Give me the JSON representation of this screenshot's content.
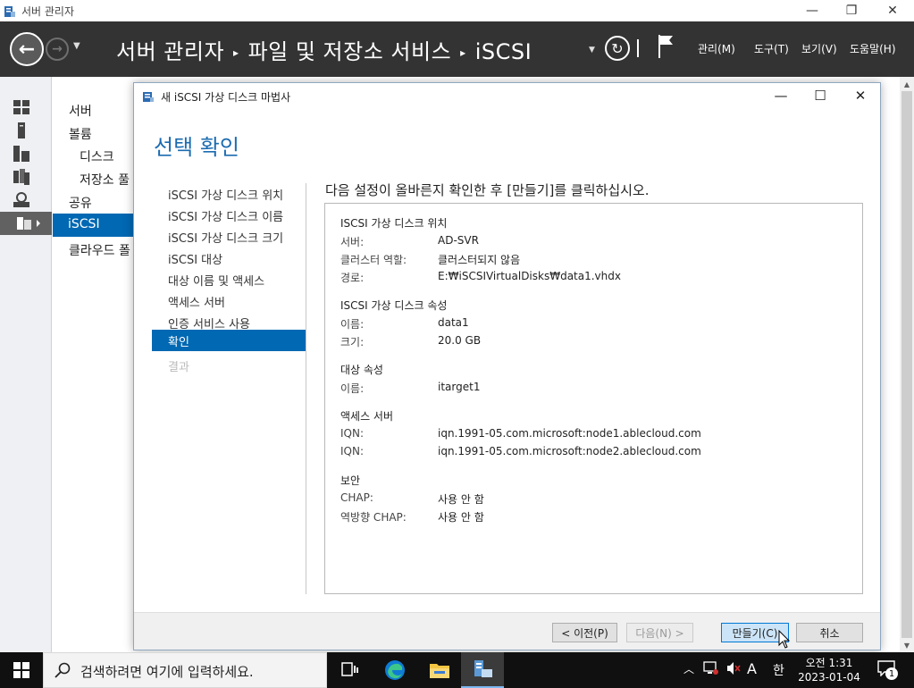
{
  "window": {
    "title": "서버 관리자"
  },
  "header": {
    "breadcrumb": [
      "서버 관리자",
      "파일 및 저장소 서비스",
      "iSCSI"
    ],
    "menus": [
      "관리(M)",
      "도구(T)",
      "보기(V)",
      "도움말(H)"
    ]
  },
  "nav": {
    "items": [
      "서버",
      "볼륨",
      "디스크",
      "저장소 풀",
      "공유",
      "iSCSI",
      "클라우드 폴"
    ]
  },
  "dialog": {
    "title": "새 iSCSI 가상 디스크 마법사",
    "heading": "선택 확인",
    "instruction": "다음 설정이 올바른지 확인한 후 [만들기]를 클릭하십시오.",
    "steps": [
      "iSCSI 가상 디스크 위치",
      "iSCSI 가상 디스크 이름",
      "iSCSI 가상 디스크 크기",
      "iSCSI 대상",
      "대상 이름 및 액세스",
      "액세스 서버",
      "인증 서비스 사용",
      "확인",
      "결과"
    ],
    "summary": {
      "location": {
        "heading": "ISCSI 가상 디스크 위치",
        "server_label": "서버:",
        "server_value": "AD-SVR",
        "cluster_label": "클러스터 역할:",
        "cluster_value": "클러스터되지 않음",
        "path_label": "경로:",
        "path_value": "E:₩iSCSIVirtualDisks₩data1.vhdx"
      },
      "properties": {
        "heading": "ISCSI 가상 디스크 속성",
        "name_label": "이름:",
        "name_value": "data1",
        "size_label": "크기:",
        "size_value": "20.0 GB"
      },
      "target": {
        "heading": "대상 속성",
        "name_label": "이름:",
        "name_value": "itarget1"
      },
      "access": {
        "heading": "액세스 서버",
        "iqn1_label": "IQN:",
        "iqn1_value": "iqn.1991-05.com.microsoft:node1.ablecloud.com",
        "iqn2_label": "IQN:",
        "iqn2_value": "iqn.1991-05.com.microsoft:node2.ablecloud.com"
      },
      "security": {
        "heading": "보안",
        "chap_label": "CHAP:",
        "chap_value": "사용 안 함",
        "rchap_label": "역방향 CHAP:",
        "rchap_value": "사용 안 함"
      }
    },
    "buttons": {
      "prev": "< 이전(P)",
      "next": "다음(N) >",
      "create": "만들기(C)",
      "cancel": "취소"
    }
  },
  "taskbar": {
    "search_placeholder": "검색하려면 여기에 입력하세요.",
    "ime_mode": "A",
    "ime_lang": "한",
    "clock_time": "오전 1:31",
    "clock_date": "2023-01-04",
    "notification_count": "1"
  }
}
